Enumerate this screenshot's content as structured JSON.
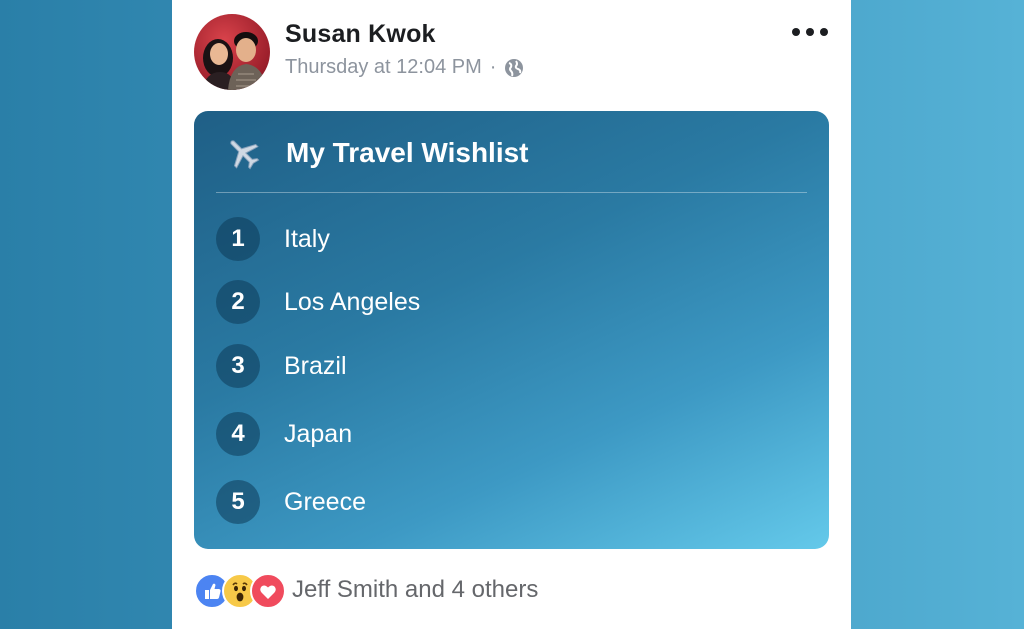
{
  "post": {
    "author": "Susan Kwok",
    "timestamp": "Thursday at 12:04 PM",
    "separator": "·",
    "privacy_icon": "globe-icon",
    "more_icon": "more-options-icon"
  },
  "list": {
    "icon": "airplane-icon",
    "title": "My Travel Wishlist",
    "items": [
      {
        "number": "1",
        "label": "Italy"
      },
      {
        "number": "2",
        "label": "Los Angeles"
      },
      {
        "number": "3",
        "label": "Brazil"
      },
      {
        "number": "4",
        "label": "Japan"
      },
      {
        "number": "5",
        "label": "Greece"
      }
    ]
  },
  "reactions": {
    "icons": [
      "like-icon",
      "wow-icon",
      "love-icon"
    ],
    "summary": "Jeff Smith and 4 others"
  },
  "colors": {
    "page_bg": "#3a93bc",
    "card_gradient_start": "#1f5f86",
    "card_gradient_end": "#64c9ea",
    "like": "#4c84f2",
    "love": "#f04b5d"
  }
}
